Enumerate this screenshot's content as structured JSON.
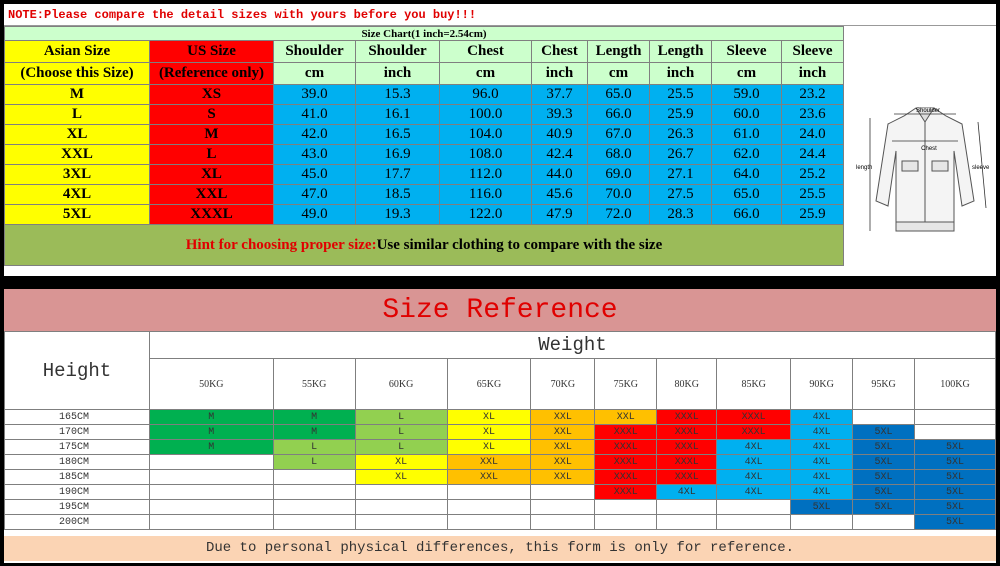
{
  "note": "NOTE:Please compare the detail sizes with yours before you buy!!!",
  "size_chart": {
    "caption": "Size Chart(1 inch=2.54cm)",
    "asian_header": [
      "Asian Size",
      "(Choose this Size)"
    ],
    "us_header": [
      "US Size",
      "(Reference only)"
    ],
    "measure_headers": [
      {
        "name": "Shoulder",
        "unit": "cm"
      },
      {
        "name": "Shoulder",
        "unit": "inch"
      },
      {
        "name": "Chest",
        "unit": "cm"
      },
      {
        "name": "Chest",
        "unit": "inch"
      },
      {
        "name": "Length",
        "unit": "cm"
      },
      {
        "name": "Length",
        "unit": "inch"
      },
      {
        "name": "Sleeve",
        "unit": "cm"
      },
      {
        "name": "Sleeve",
        "unit": "inch"
      }
    ],
    "rows": [
      {
        "asian": "M",
        "us": "XS",
        "vals": [
          "39.0",
          "15.3",
          "96.0",
          "37.7",
          "65.0",
          "25.5",
          "59.0",
          "23.2"
        ]
      },
      {
        "asian": "L",
        "us": "S",
        "vals": [
          "41.0",
          "16.1",
          "100.0",
          "39.3",
          "66.0",
          "25.9",
          "60.0",
          "23.6"
        ]
      },
      {
        "asian": "XL",
        "us": "M",
        "vals": [
          "42.0",
          "16.5",
          "104.0",
          "40.9",
          "67.0",
          "26.3",
          "61.0",
          "24.0"
        ]
      },
      {
        "asian": "XXL",
        "us": "L",
        "vals": [
          "43.0",
          "16.9",
          "108.0",
          "42.4",
          "68.0",
          "26.7",
          "62.0",
          "24.4"
        ]
      },
      {
        "asian": "3XL",
        "us": "XL",
        "vals": [
          "45.0",
          "17.7",
          "112.0",
          "44.0",
          "69.0",
          "27.1",
          "64.0",
          "25.2"
        ]
      },
      {
        "asian": "4XL",
        "us": "XXL",
        "vals": [
          "47.0",
          "18.5",
          "116.0",
          "45.6",
          "70.0",
          "27.5",
          "65.0",
          "25.5"
        ]
      },
      {
        "asian": "5XL",
        "us": "XXXL",
        "vals": [
          "49.0",
          "19.3",
          "122.0",
          "47.9",
          "72.0",
          "28.3",
          "66.0",
          "25.9"
        ]
      }
    ],
    "hint_label": "Hint for choosing proper size:",
    "hint_text": "Use similar clothing to compare with the size"
  },
  "figure": {
    "shoulder": "Shoulder",
    "chest": "Chest",
    "length": "length",
    "sleeve": "sleeve"
  },
  "reference": {
    "title": "Size Reference",
    "height_label": "Height",
    "weight_label": "Weight",
    "weights": [
      "50KG",
      "55KG",
      "60KG",
      "65KG",
      "70KG",
      "75KG",
      "80KG",
      "85KG",
      "90KG",
      "95KG",
      "100KG"
    ],
    "footer": "Due to personal physical differences, this form is only for reference.",
    "rows": [
      {
        "height": "165CM",
        "cells": [
          {
            "t": "M",
            "c": "g"
          },
          {
            "t": "M",
            "c": "g"
          },
          {
            "t": "L",
            "c": "lg"
          },
          {
            "t": "XL",
            "c": "y"
          },
          {
            "t": "XXL",
            "c": "o"
          },
          {
            "t": "XXL",
            "c": "o"
          },
          {
            "t": "XXXL",
            "c": "r"
          },
          {
            "t": "XXXL",
            "c": "r"
          },
          {
            "t": "4XL",
            "c": "b"
          },
          {
            "t": "",
            "c": ""
          },
          {
            "t": "",
            "c": ""
          }
        ]
      },
      {
        "height": "170CM",
        "cells": [
          {
            "t": "M",
            "c": "g"
          },
          {
            "t": "M",
            "c": "g"
          },
          {
            "t": "L",
            "c": "lg"
          },
          {
            "t": "XL",
            "c": "y"
          },
          {
            "t": "XXL",
            "c": "o"
          },
          {
            "t": "XXXL",
            "c": "r"
          },
          {
            "t": "XXXL",
            "c": "r"
          },
          {
            "t": "XXXL",
            "c": "r"
          },
          {
            "t": "4XL",
            "c": "b"
          },
          {
            "t": "5XL",
            "c": "db"
          },
          {
            "t": "",
            "c": ""
          }
        ]
      },
      {
        "height": "175CM",
        "cells": [
          {
            "t": "M",
            "c": "g"
          },
          {
            "t": "L",
            "c": "lg"
          },
          {
            "t": "L",
            "c": "lg"
          },
          {
            "t": "XL",
            "c": "y"
          },
          {
            "t": "XXL",
            "c": "o"
          },
          {
            "t": "XXXL",
            "c": "r"
          },
          {
            "t": "XXXL",
            "c": "r"
          },
          {
            "t": "4XL",
            "c": "b"
          },
          {
            "t": "4XL",
            "c": "b"
          },
          {
            "t": "5XL",
            "c": "db"
          },
          {
            "t": "5XL",
            "c": "db"
          }
        ]
      },
      {
        "height": "180CM",
        "cells": [
          {
            "t": "",
            "c": ""
          },
          {
            "t": "L",
            "c": "lg"
          },
          {
            "t": "XL",
            "c": "y"
          },
          {
            "t": "XXL",
            "c": "o"
          },
          {
            "t": "XXL",
            "c": "o"
          },
          {
            "t": "XXXL",
            "c": "r"
          },
          {
            "t": "XXXL",
            "c": "r"
          },
          {
            "t": "4XL",
            "c": "b"
          },
          {
            "t": "4XL",
            "c": "b"
          },
          {
            "t": "5XL",
            "c": "db"
          },
          {
            "t": "5XL",
            "c": "db"
          }
        ]
      },
      {
        "height": "185CM",
        "cells": [
          {
            "t": "",
            "c": ""
          },
          {
            "t": "",
            "c": ""
          },
          {
            "t": "XL",
            "c": "y"
          },
          {
            "t": "XXL",
            "c": "o"
          },
          {
            "t": "XXL",
            "c": "o"
          },
          {
            "t": "XXXL",
            "c": "r"
          },
          {
            "t": "XXXL",
            "c": "r"
          },
          {
            "t": "4XL",
            "c": "b"
          },
          {
            "t": "4XL",
            "c": "b"
          },
          {
            "t": "5XL",
            "c": "db"
          },
          {
            "t": "5XL",
            "c": "db"
          }
        ]
      },
      {
        "height": "190CM",
        "cells": [
          {
            "t": "",
            "c": ""
          },
          {
            "t": "",
            "c": ""
          },
          {
            "t": "",
            "c": ""
          },
          {
            "t": "",
            "c": ""
          },
          {
            "t": "",
            "c": ""
          },
          {
            "t": "XXXL",
            "c": "r"
          },
          {
            "t": "4XL",
            "c": "b"
          },
          {
            "t": "4XL",
            "c": "b"
          },
          {
            "t": "4XL",
            "c": "b"
          },
          {
            "t": "5XL",
            "c": "db"
          },
          {
            "t": "5XL",
            "c": "db"
          }
        ]
      },
      {
        "height": "195CM",
        "cells": [
          {
            "t": "",
            "c": ""
          },
          {
            "t": "",
            "c": ""
          },
          {
            "t": "",
            "c": ""
          },
          {
            "t": "",
            "c": ""
          },
          {
            "t": "",
            "c": ""
          },
          {
            "t": "",
            "c": ""
          },
          {
            "t": "",
            "c": ""
          },
          {
            "t": "",
            "c": ""
          },
          {
            "t": "5XL",
            "c": "db"
          },
          {
            "t": "5XL",
            "c": "db"
          },
          {
            "t": "5XL",
            "c": "db"
          }
        ]
      },
      {
        "height": "200CM",
        "cells": [
          {
            "t": "",
            "c": ""
          },
          {
            "t": "",
            "c": ""
          },
          {
            "t": "",
            "c": ""
          },
          {
            "t": "",
            "c": ""
          },
          {
            "t": "",
            "c": ""
          },
          {
            "t": "",
            "c": ""
          },
          {
            "t": "",
            "c": ""
          },
          {
            "t": "",
            "c": ""
          },
          {
            "t": "",
            "c": ""
          },
          {
            "t": "",
            "c": ""
          },
          {
            "t": "5XL",
            "c": "db"
          }
        ]
      }
    ]
  }
}
